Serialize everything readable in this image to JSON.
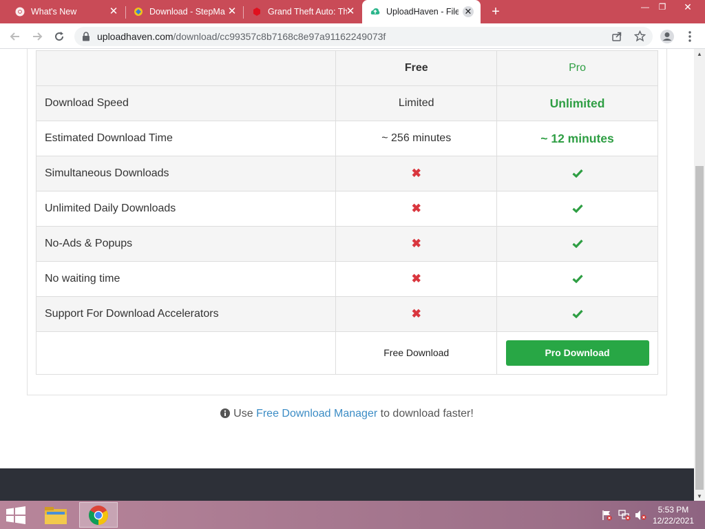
{
  "browser": {
    "tabs": [
      {
        "title": "What's New",
        "favicon": "chrome-icon",
        "active": false
      },
      {
        "title": "Download - StepMa",
        "favicon": "stepmania-icon",
        "active": false
      },
      {
        "title": "Grand Theft Auto: Th",
        "favicon": "gta-icon",
        "active": false
      },
      {
        "title": "UploadHaven - File",
        "favicon": "uploadhaven-icon",
        "active": true
      }
    ],
    "url_domain": "uploadhaven.com",
    "url_path": "/download/cc99357c8b7168c8e97a91162249073f"
  },
  "comparison": {
    "header": {
      "free": "Free",
      "pro": "Pro"
    },
    "rows": [
      {
        "feature": "Download Speed",
        "free": "Limited",
        "pro": "Unlimited"
      },
      {
        "feature": "Estimated Download Time",
        "free": "~ 256 minutes",
        "pro": "~ 12 minutes"
      },
      {
        "feature": "Simultaneous Downloads",
        "free": "cross",
        "pro": "check"
      },
      {
        "feature": "Unlimited Daily Downloads",
        "free": "cross",
        "pro": "check"
      },
      {
        "feature": "No-Ads & Popups",
        "free": "cross",
        "pro": "check"
      },
      {
        "feature": "No waiting time",
        "free": "cross",
        "pro": "check"
      },
      {
        "feature": "Support For Download Accelerators",
        "free": "cross",
        "pro": "check"
      }
    ],
    "free_download_label": "Free Download",
    "pro_download_label": "Pro Download"
  },
  "hint": {
    "prefix": "Use",
    "link": "Free Download Manager",
    "suffix": "to download faster!"
  },
  "colors": {
    "tabstrip": "#c94b57",
    "pro_green": "#28a745",
    "cross_red": "#d9363e",
    "link_blue": "#3b8cc5"
  },
  "taskbar": {
    "time": "5:53 PM",
    "date": "12/22/2021"
  }
}
